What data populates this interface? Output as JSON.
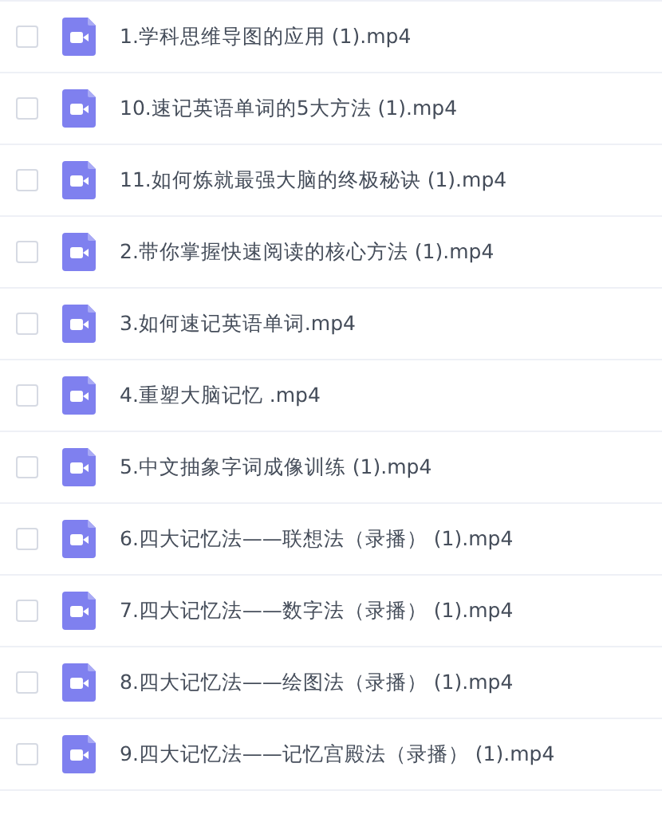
{
  "files": [
    {
      "name": "1.学科思维导图的应用 (1).mp4",
      "checked": false
    },
    {
      "name": "10.速记英语单词的5大方法 (1).mp4",
      "checked": false
    },
    {
      "name": "11.如何炼就最强大脑的终极秘诀 (1).mp4",
      "checked": false
    },
    {
      "name": "2.带你掌握快速阅读的核心方法 (1).mp4",
      "checked": false
    },
    {
      "name": "3.如何速记英语单词.mp4",
      "checked": false
    },
    {
      "name": "4.重塑大脑记忆 .mp4",
      "checked": false
    },
    {
      "name": "5.中文抽象字词成像训练 (1).mp4",
      "checked": false
    },
    {
      "name": "6.四大记忆法——联想法（录播） (1).mp4",
      "checked": false
    },
    {
      "name": "7.四大记忆法——数字法（录播） (1).mp4",
      "checked": false
    },
    {
      "name": "8.四大记忆法——绘图法（录播） (1).mp4",
      "checked": false
    },
    {
      "name": "9.四大记忆法——记忆宫殿法（录播） (1).mp4",
      "checked": false
    }
  ]
}
